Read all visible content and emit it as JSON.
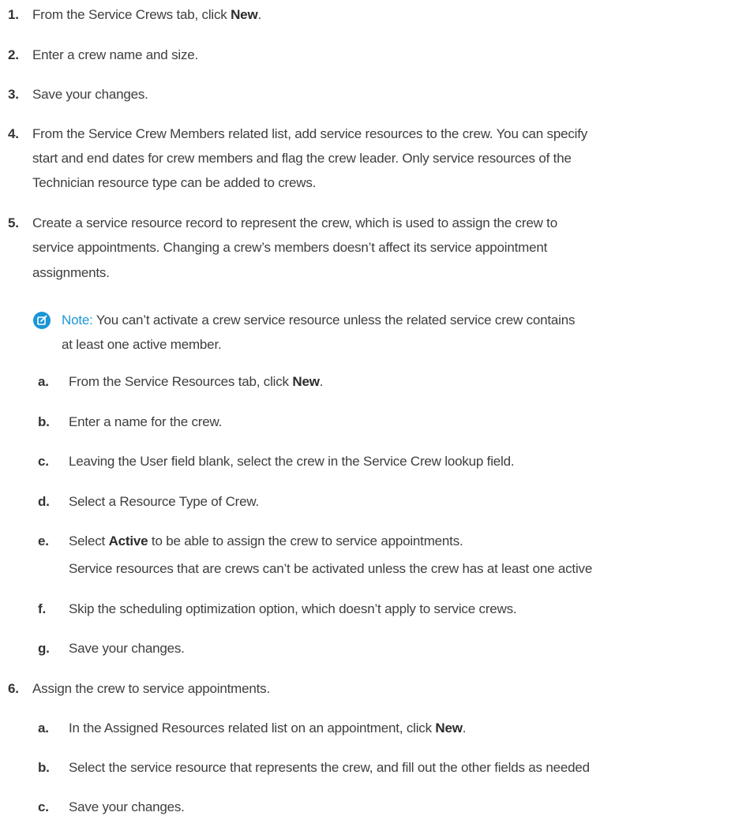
{
  "steps": [
    {
      "num": "1.",
      "pre": "From the Service Crews tab, click ",
      "bold": "New",
      "post": "."
    },
    {
      "num": "2.",
      "text": "Enter a crew name and size."
    },
    {
      "num": "3.",
      "text": "Save your changes."
    },
    {
      "num": "4.",
      "lines": [
        "From the Service Crew Members related list, add service resources to the crew. You can specify",
        "start and end dates for crew members and flag the crew leader. Only service resources of the",
        "Technician resource type can be added to crews."
      ]
    },
    {
      "num": "5.",
      "lines": [
        "Create a service resource record to represent the crew, which is used to assign the crew to",
        "service appointments. Changing a crew’s members doesn’t affect its service appointment",
        "assignments."
      ]
    },
    {
      "num": "6.",
      "text": "Assign the crew to service appointments."
    }
  ],
  "note": {
    "label": "Note:",
    "line1": "You can’t activate a crew service resource unless the related service crew contains",
    "line2": "at least one active member."
  },
  "substeps5": [
    {
      "letter": "a.",
      "pre": "From the Service Resources tab, click ",
      "bold": "New",
      "post": "."
    },
    {
      "letter": "b.",
      "text": "Enter a name for the crew."
    },
    {
      "letter": "c.",
      "text": "Leaving the User field blank, select the crew in the Service Crew lookup field."
    },
    {
      "letter": "d.",
      "text": "Select a Resource Type of Crew."
    },
    {
      "letter": "e.",
      "pre": "Select ",
      "bold": "Active",
      "post": " to be able to assign the crew to service appointments.",
      "extra": "Service resources that are crews can’t be activated unless the crew has at least one active"
    },
    {
      "letter": "f.",
      "text": "Skip the scheduling optimization option, which doesn’t apply to service crews."
    },
    {
      "letter": "g.",
      "text": "Save your changes."
    }
  ],
  "substeps6": [
    {
      "letter": "a.",
      "pre": "In the Assigned Resources related list on an appointment, click ",
      "bold": "New",
      "post": "."
    },
    {
      "letter": "b.",
      "text": "Select the service resource that represents the crew, and fill out the other fields as needed"
    },
    {
      "letter": "c.",
      "text": "Save your changes."
    }
  ],
  "icons": {
    "note": "edit-note-icon"
  },
  "colors": {
    "accent": "#1b96d6",
    "text": "#3e3e3c"
  }
}
